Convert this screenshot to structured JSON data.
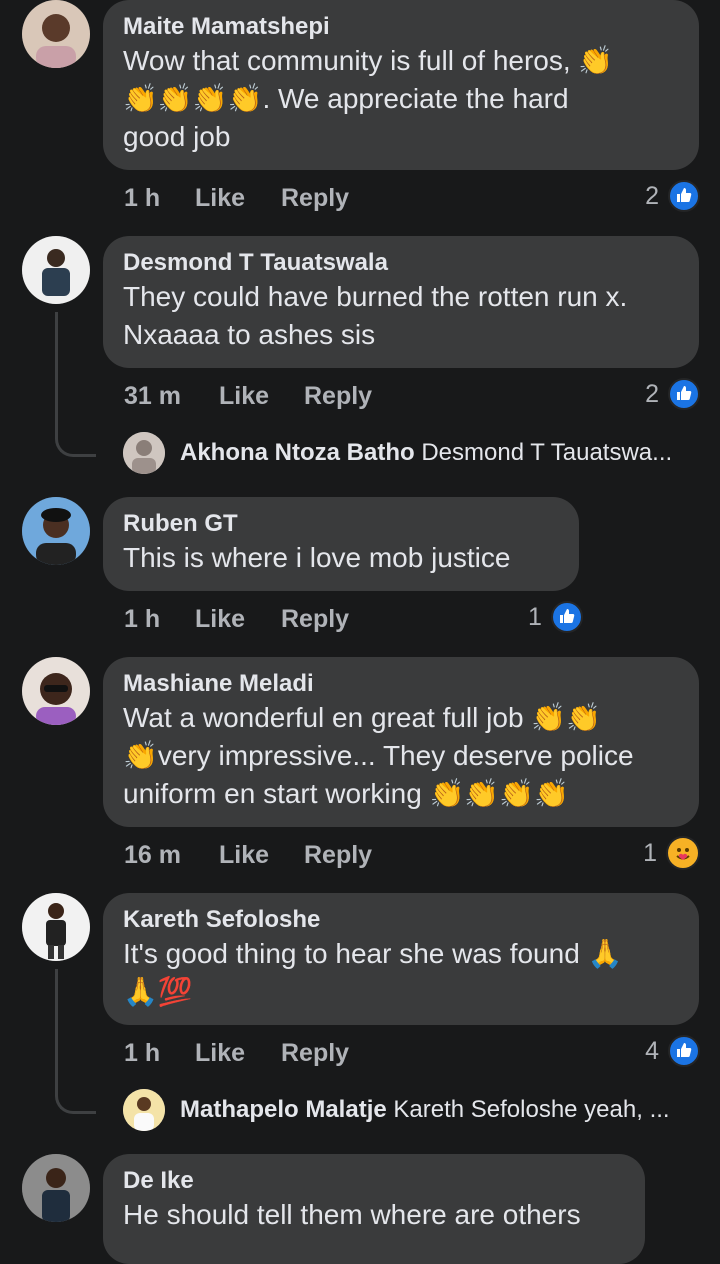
{
  "comments": [
    {
      "name": "Maite Mamatshepi",
      "text1": "Wow that community is full of heros, 👏",
      "text2": "👏👏👏👏. We appreciate the hard",
      "text3": "good job",
      "time": "1 h",
      "like": "Like",
      "reply": "Reply",
      "reactions": "2"
    },
    {
      "name": "Desmond T Tauatswala",
      "text1": "They could have burned the rotten run x.",
      "text2": "Nxaaaa to ashes sis",
      "time": "31 m",
      "like": "Like",
      "reply": "Reply",
      "reactions": "2",
      "reply_preview": {
        "name": "Akhona Ntoza Batho",
        "snippet": "Desmond T Tauatswa..."
      }
    },
    {
      "name": "Ruben GT",
      "text1": "This is where i love mob justice",
      "time": "1 h",
      "like": "Like",
      "reply": "Reply",
      "reactions": "1"
    },
    {
      "name": "Mashiane Meladi",
      "text1": "Wat a wonderful en great full job 👏👏",
      "text2": "👏very impressive... They deserve police",
      "text3": "uniform  en start working 👏👏👏👏",
      "time": "16 m",
      "like": "Like",
      "reply": "Reply",
      "reactions": "1"
    },
    {
      "name": "Kareth Sefoloshe",
      "text1": "It's good thing to hear  she was found 🙏",
      "text2": "🙏💯",
      "time": "1 h",
      "like": "Like",
      "reply": "Reply",
      "reactions": "4",
      "reply_preview": {
        "name": "Mathapelo Malatje",
        "snippet": "Kareth Sefoloshe yeah, ..."
      }
    },
    {
      "name": "De Ike",
      "text1": "He should tell them where are others"
    }
  ],
  "colors": {
    "background": "#18191a",
    "bubble": "#3a3b3c",
    "like_blue": "#1b74e4",
    "meta_text": "#b0b3b8"
  }
}
